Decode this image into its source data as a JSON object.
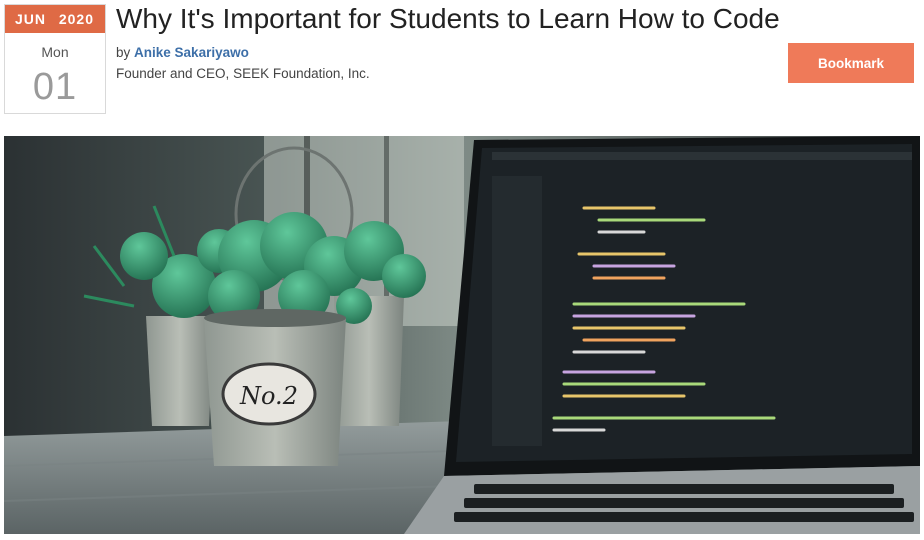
{
  "post": {
    "month": "JUN",
    "year": "2020",
    "weekday": "Mon",
    "day": "01",
    "title": "Why It's Important for Students to Learn How to Code",
    "by_prefix": "by",
    "author": "Anike Sakariyawo",
    "affiliation": "Founder and CEO, SEEK Foundation, Inc."
  },
  "actions": {
    "bookmark_label": "Bookmark"
  },
  "hero_image": {
    "pot_label": "No.2",
    "colors": {
      "accent": "#df6a45",
      "button": "#ef7a59",
      "author_link": "#3d6fa8"
    }
  }
}
